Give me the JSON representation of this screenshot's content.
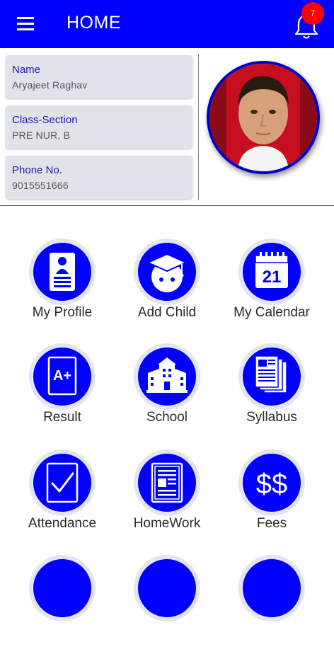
{
  "appbar": {
    "title": "HOME",
    "menu_icon": "hamburger-menu-icon",
    "notification_icon": "bell-icon",
    "notification_count": "7"
  },
  "profile": {
    "fields": [
      {
        "label": "Name",
        "value": "Aryajeet Raghav"
      },
      {
        "label": "Class-Section",
        "value": "PRE NUR, B"
      },
      {
        "label": "Phone No.",
        "value": "9015551666"
      }
    ]
  },
  "menu": {
    "items": [
      {
        "label": "My Profile",
        "icon": "id-card-icon"
      },
      {
        "label": "Add Child",
        "icon": "graduate-child-icon"
      },
      {
        "label": "My Calendar",
        "icon": "calendar-icon",
        "calendar_day": "21"
      },
      {
        "label": "Result",
        "icon": "grade-a-plus-icon",
        "grade": "A+"
      },
      {
        "label": "School",
        "icon": "school-building-icon"
      },
      {
        "label": "Syllabus",
        "icon": "documents-icon"
      },
      {
        "label": "Attendance",
        "icon": "checkmark-icon"
      },
      {
        "label": "HomeWork",
        "icon": "notebook-icon"
      },
      {
        "label": "Fees",
        "icon": "dollar-icon",
        "symbol": "$$"
      }
    ]
  },
  "colors": {
    "primary": "#0000ff",
    "badge": "#ff0000",
    "card_bg": "#e2e2ea",
    "label_text": "#1a1ab0"
  }
}
